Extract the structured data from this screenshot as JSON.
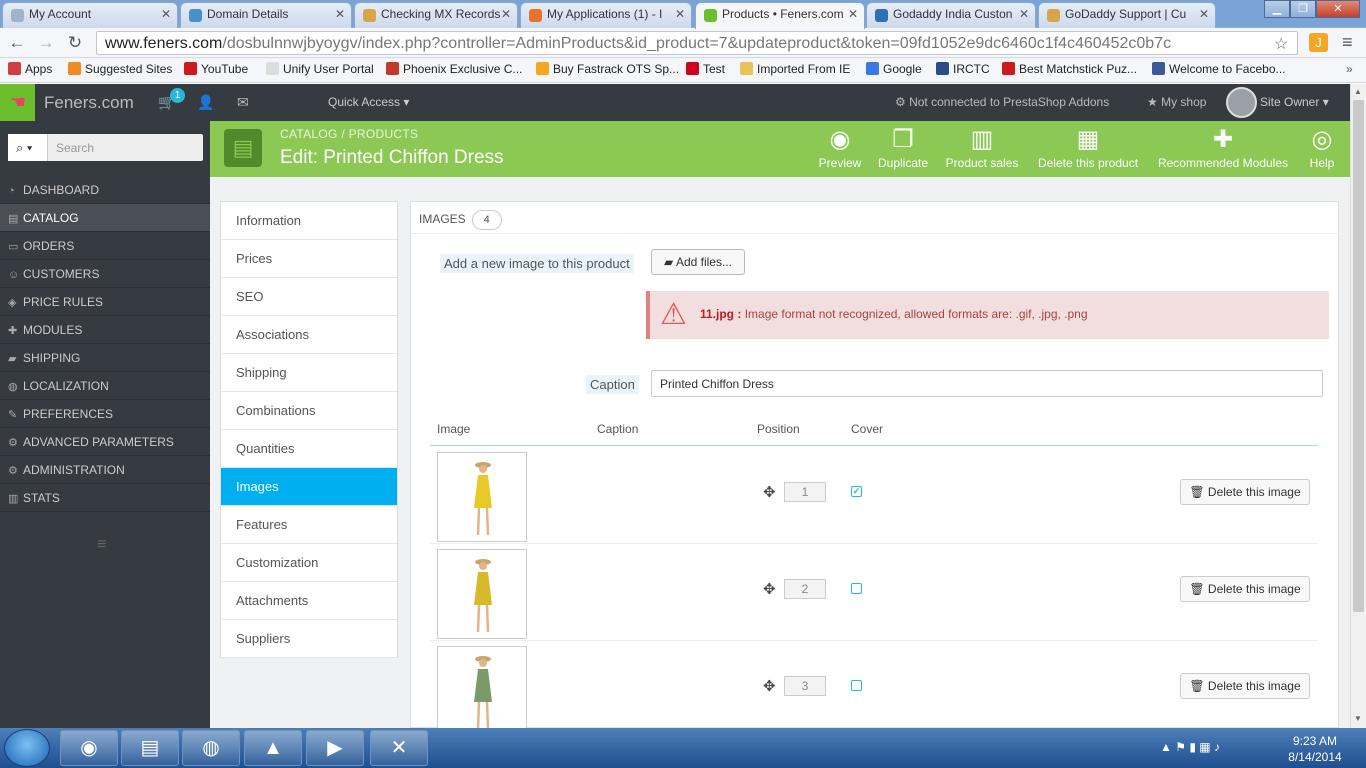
{
  "browser": {
    "tabs": [
      {
        "label": "My Account",
        "favicon_color": "#9fb4c8"
      },
      {
        "label": "Domain Details",
        "favicon_color": "#4a90c8"
      },
      {
        "label": "Checking MX Records",
        "favicon_color": "#d9a54a"
      },
      {
        "label": "My Applications (1) - I",
        "favicon_color": "#e8742c"
      },
      {
        "label": "Products • Feners.com",
        "favicon_color": "#6bbf2c"
      },
      {
        "label": "Godaddy India Custon",
        "favicon_color": "#2f6fb3"
      },
      {
        "label": "GoDaddy Support | Cu",
        "favicon_color": "#d9a54a"
      }
    ],
    "url_domain": "www.feners.com",
    "url_path": "/dosbulnnwjbyoygv/index.php?controller=AdminProducts&id_product=7&updateproduct&token=09fd1052e9dc6460c1f4c460452c0b7c",
    "bookmarks": [
      {
        "label": "Apps",
        "color": "#d04040"
      },
      {
        "label": "Suggested Sites",
        "color": "#f08a24"
      },
      {
        "label": "YouTube",
        "color": "#cc1b1b"
      },
      {
        "label": "Unify User Portal",
        "color": "#dddddd"
      },
      {
        "label": "Phoenix Exclusive C...",
        "color": "#c0392b"
      },
      {
        "label": "Buy Fastrack OTS Sp...",
        "color": "#f5a623"
      },
      {
        "label": "Test",
        "color": "#d0021b"
      },
      {
        "label": "Imported From IE",
        "color": "#e8c25a"
      },
      {
        "label": "Google",
        "color": "#3b78e7"
      },
      {
        "label": "IRCTC",
        "color": "#2a4a8a"
      },
      {
        "label": "Best Matchstick Puz...",
        "color": "#cc1b1b"
      },
      {
        "label": "Welcome to Facebo...",
        "color": "#3b5998"
      }
    ]
  },
  "header": {
    "title": "Feners.com",
    "cart_badge": "1",
    "quick_access": "Quick Access",
    "addons_status": "Not connected to PrestaShop Addons",
    "my_shop": "My shop",
    "user": "Site Owner"
  },
  "sidebar": {
    "search_placeholder": "Search",
    "items": [
      {
        "label": "DASHBOARD",
        "icon": "dashboard-icon",
        "glyph": "◔"
      },
      {
        "label": "CATALOG",
        "icon": "book-icon",
        "glyph": "▤"
      },
      {
        "label": "ORDERS",
        "icon": "card-icon",
        "glyph": "▭"
      },
      {
        "label": "CUSTOMERS",
        "icon": "users-icon",
        "glyph": "☺"
      },
      {
        "label": "PRICE RULES",
        "icon": "tag-icon",
        "glyph": "◈"
      },
      {
        "label": "MODULES",
        "icon": "puzzle-icon",
        "glyph": "✚"
      },
      {
        "label": "SHIPPING",
        "icon": "truck-icon",
        "glyph": "▰"
      },
      {
        "label": "LOCALIZATION",
        "icon": "globe-icon",
        "glyph": "◍"
      },
      {
        "label": "PREFERENCES",
        "icon": "wrench-icon",
        "glyph": "✎"
      },
      {
        "label": "ADVANCED PARAMETERS",
        "icon": "cogs-icon",
        "glyph": "⚙"
      },
      {
        "label": "ADMINISTRATION",
        "icon": "cog-icon",
        "glyph": "⚙"
      },
      {
        "label": "STATS",
        "icon": "bar-chart-icon",
        "glyph": "▥"
      }
    ]
  },
  "toolbar": {
    "breadcrumb_1": "CATALOG",
    "breadcrumb_sep": "/",
    "breadcrumb_2": "PRODUCTS",
    "title": "Edit: Printed Chiffon Dress",
    "buttons": [
      {
        "label": "Preview",
        "icon": "eye-icon",
        "glyph": "◉"
      },
      {
        "label": "Duplicate",
        "icon": "copy-icon",
        "glyph": "❐"
      },
      {
        "label": "Product sales",
        "icon": "chart-icon",
        "glyph": "▥"
      },
      {
        "label": "Delete this product",
        "icon": "trash-icon",
        "glyph": "▦"
      },
      {
        "label": "Recommended Modules",
        "icon": "puzzle-icon",
        "glyph": "✚"
      },
      {
        "label": "Help",
        "icon": "lifebuoy-icon",
        "glyph": "◎"
      }
    ]
  },
  "subnav": [
    "Information",
    "Prices",
    "SEO",
    "Associations",
    "Shipping",
    "Combinations",
    "Quantities",
    "Images",
    "Features",
    "Customization",
    "Attachments",
    "Suppliers"
  ],
  "images": {
    "heading": "IMAGES",
    "count": "4",
    "add_label": "Add a new image to this product",
    "add_button": "Add files...",
    "error_file": "11.jpg :",
    "error_msg": "Image format not recognized, allowed formats are: .gif, .jpg, .png",
    "caption_label": "Caption",
    "caption_value": "Printed Chiffon Dress",
    "col_image": "Image",
    "col_caption": "Caption",
    "col_position": "Position",
    "col_cover": "Cover",
    "delete_label": "Delete this image",
    "rows": [
      {
        "position": "1",
        "cover": true,
        "dress_color": "#e8c92a"
      },
      {
        "position": "2",
        "cover": false,
        "dress_color": "#d8b92a"
      },
      {
        "position": "3",
        "cover": false,
        "dress_color": "#7a9a6a"
      }
    ]
  },
  "taskbar": {
    "time": "9:23 AM",
    "date": "8/14/2014"
  }
}
